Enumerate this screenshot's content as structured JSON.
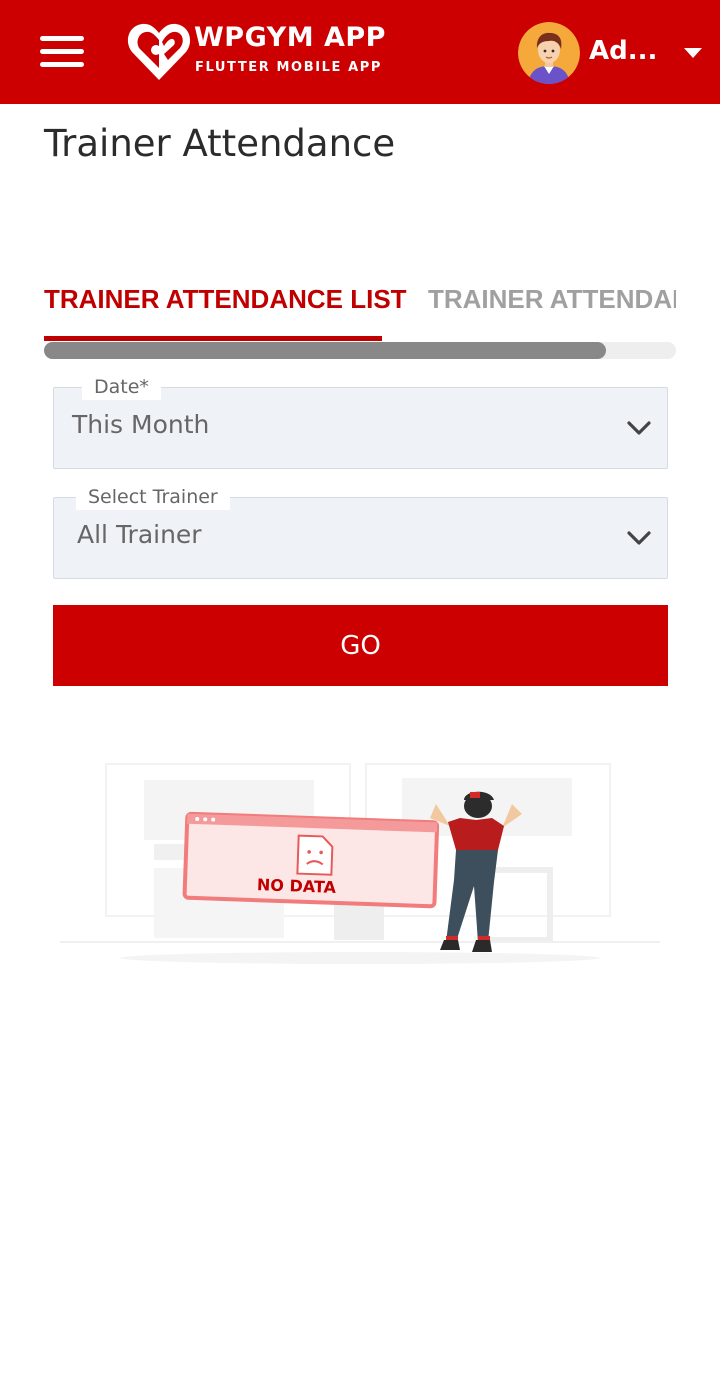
{
  "header": {
    "app_title": "WPGYM APP",
    "app_subtitle": "FLUTTER MOBILE APP",
    "user_name": "Ad...",
    "brand_color": "#cc0000"
  },
  "page": {
    "title": "Trainer Attendance"
  },
  "tabs": [
    {
      "label": "TRAINER ATTENDANCE LIST",
      "active": true
    },
    {
      "label": "TRAINER ATTENDAN",
      "active": false
    }
  ],
  "filters": {
    "date": {
      "label": "Date*",
      "value": "This Month"
    },
    "trainer": {
      "label": "Select Trainer",
      "value": "All Trainer"
    }
  },
  "go_button": {
    "label": "GO"
  },
  "empty_state": {
    "text": "NO DATA"
  },
  "icons": [
    "menu-icon",
    "brand-heart-logo",
    "user-avatar",
    "caret-down-icon",
    "chevron-down-icon",
    "sad-document-icon"
  ]
}
